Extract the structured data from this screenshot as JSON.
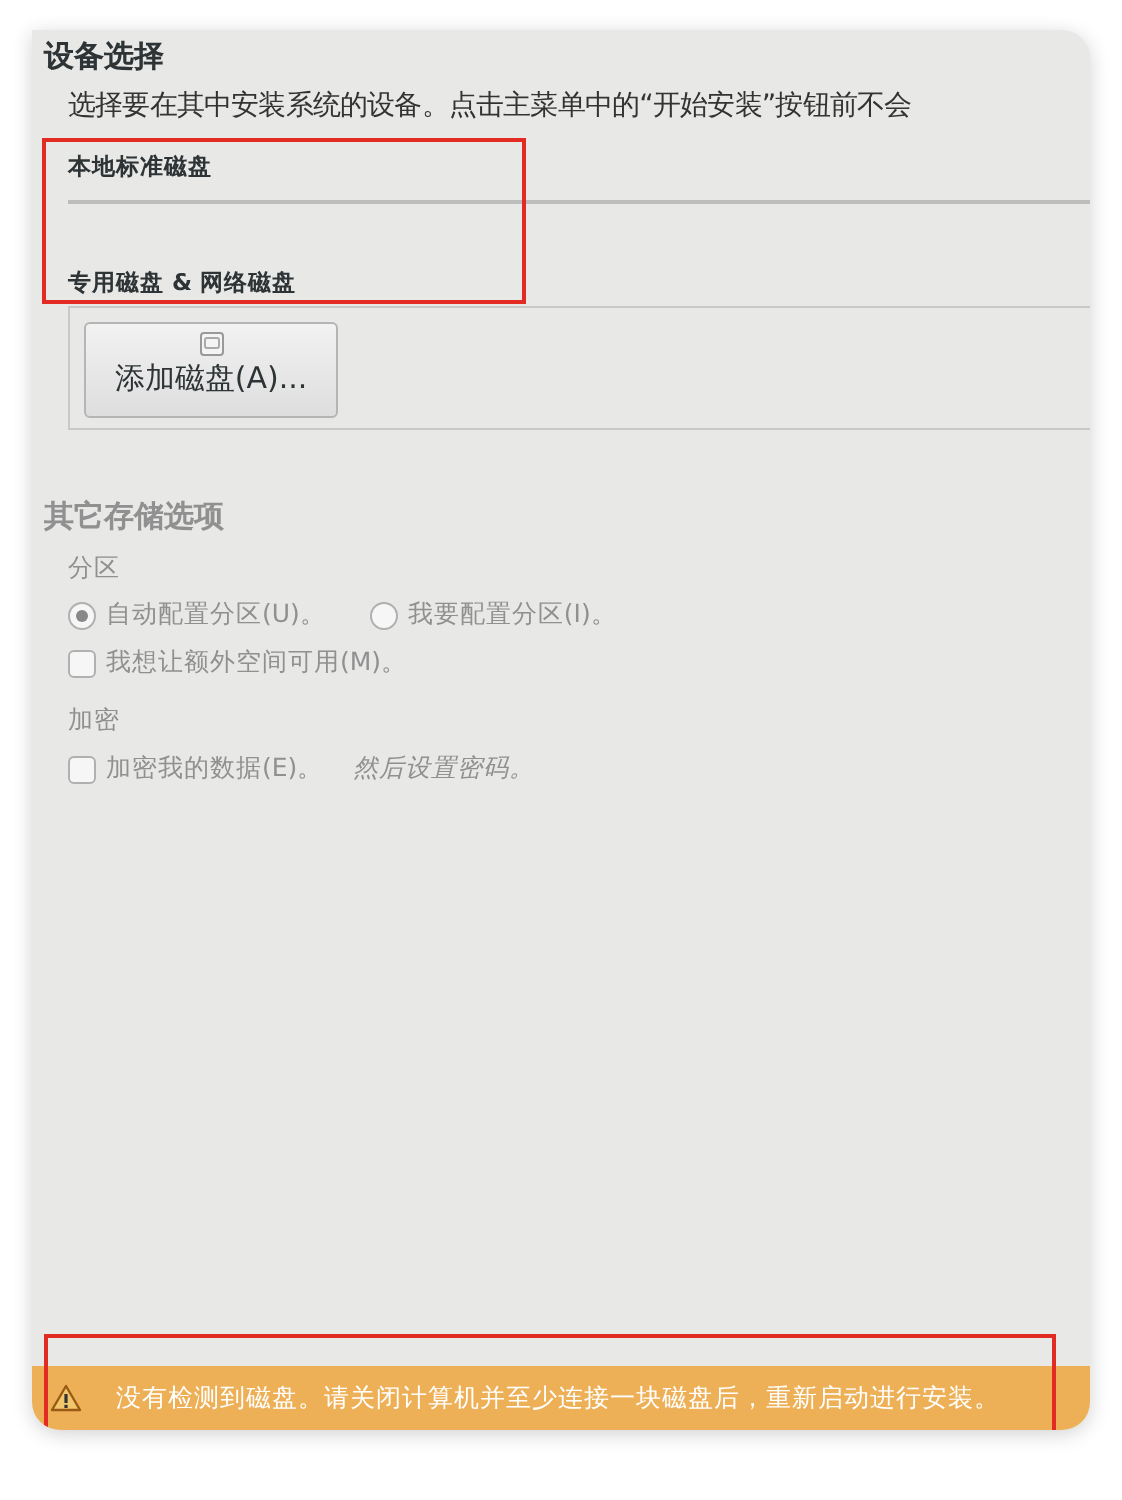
{
  "title": "设备选择",
  "description": "选择要在其中安装系统的设备。点击主菜单中的“开始安装”按钮前不会",
  "disk_sections": {
    "highlighted": true,
    "local_heading": "本地标准磁盘",
    "network_heading": "专用磁盘 & 网络磁盘"
  },
  "add_disk_button": {
    "label": "添加磁盘(A)..."
  },
  "other_storage": {
    "heading": "其它存储选项",
    "disabled": true,
    "partitioning": {
      "heading": "分区",
      "options": [
        {
          "label": "自动配置分区(U)。",
          "selected": true
        },
        {
          "label": "我要配置分区(I)。",
          "selected": false
        }
      ],
      "extra_space": {
        "label": "我想让额外空间可用(M)。",
        "checked": false
      }
    },
    "encryption": {
      "heading": "加密",
      "encrypt": {
        "label": "加密我的数据(E)。",
        "checked": false,
        "hint": "然后设置密码。"
      }
    }
  },
  "warning": {
    "highlighted": true,
    "kind": "warning",
    "text": "没有检测到磁盘。请关闭计算机并至少连接一块磁盘后，重新启动进行安装。"
  }
}
